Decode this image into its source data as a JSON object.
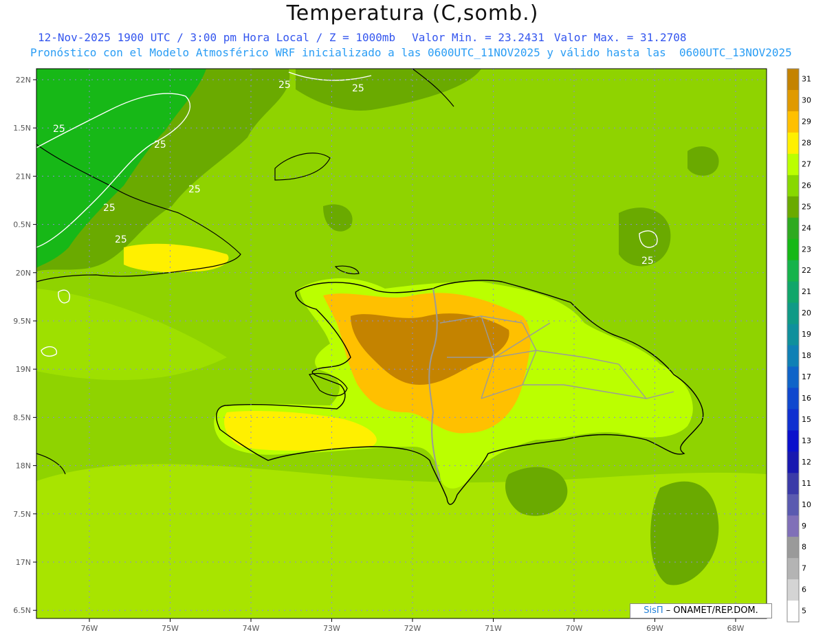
{
  "title": "Temperatura (C,somb.)",
  "subtitle": {
    "valid_time": "12-Nov-2025 1900 UTC / 3:00 pm Hora Local / Z = 1000mb",
    "min": "Valor Min. = 23.2431",
    "max": "Valor Max. = 31.2708",
    "model": "Pronóstico con el Modelo Atmosférico WRF inicializado a las 0600UTC_11NOV2025 y válido hasta las  0600UTC_13NOV2025"
  },
  "credit": {
    "brand": "SisΠ",
    "text": "– ONAMET/REP.DOM."
  },
  "lat_labels": [
    "22N",
    "1.5N",
    "21N",
    "0.5N",
    "20N",
    "9.5N",
    "19N",
    "8.5N",
    "18N",
    "7.5N",
    "17N",
    "6.5N"
  ],
  "lon_labels": [
    "76W",
    "75W",
    "74W",
    "73W",
    "72W",
    "71W",
    "70W",
    "69W",
    "68W"
  ],
  "contour_labels": [
    "25",
    "25",
    "25",
    "25",
    "25",
    "25",
    "25",
    "25",
    "25"
  ],
  "colorbar": {
    "labels": [
      "31",
      "30",
      "29",
      "28",
      "27",
      "26",
      "25",
      "24",
      "23",
      "22",
      "21",
      "20",
      "19",
      "18",
      "17",
      "16",
      "15",
      "13",
      "12",
      "11",
      "10",
      "9",
      "8",
      "7",
      "6",
      "5"
    ],
    "colors": [
      "#c48300",
      "#e09a00",
      "#ffc000",
      "#fff000",
      "#bbff00",
      "#88d800",
      "#6aaa00",
      "#2faa20",
      "#17b817",
      "#16b34b",
      "#11a66a",
      "#109a86",
      "#10909c",
      "#1080b5",
      "#1064c8",
      "#1048ce",
      "#1030d0",
      "#0a10cc",
      "#1818b0",
      "#3a3aa8",
      "#5a5ab0",
      "#8070b8",
      "#9a9a9a",
      "#b4b4b4",
      "#d4d4d4",
      "#ffffff"
    ]
  },
  "colors": {
    "sea_base": "#8fd300",
    "warm_land": "#ffc000",
    "hot_land": "#c48300",
    "cool_sea": "#6aaa00",
    "cold_sea": "#17b817"
  }
}
